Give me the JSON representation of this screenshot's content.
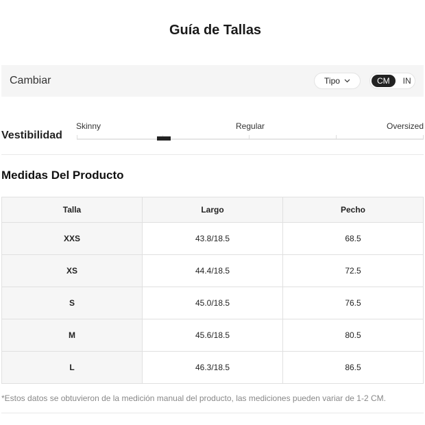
{
  "header": {
    "title": "Guía de Tallas"
  },
  "toolbar": {
    "change_label": "Cambiar",
    "type_label": "Tipo",
    "units": {
      "active": "CM",
      "inactive": "IN"
    }
  },
  "fit": {
    "label": "Vestibilidad",
    "scale": [
      "Skinny",
      "Regular",
      "Oversized"
    ],
    "indicator_fraction": 0.25
  },
  "measurements": {
    "title": "Medidas Del Producto",
    "columns": [
      "Talla",
      "Largo",
      "Pecho"
    ],
    "rows": [
      [
        "XXS",
        "43.8/18.5",
        "68.5"
      ],
      [
        "XS",
        "44.4/18.5",
        "72.5"
      ],
      [
        "S",
        "45.0/18.5",
        "76.5"
      ],
      [
        "M",
        "45.6/18.5",
        "80.5"
      ],
      [
        "L",
        "46.3/18.5",
        "86.5"
      ]
    ]
  },
  "footnote": "*Estos datos se obtuvieron de la medición manual del producto, las mediciones pueden variar de 1-2 CM.",
  "colors": {
    "active_unit_bg": "#222222",
    "bar_bg": "#f5f5f5"
  }
}
